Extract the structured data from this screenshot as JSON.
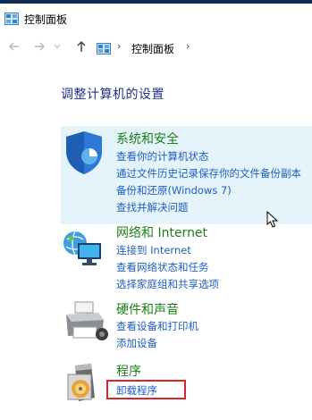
{
  "window": {
    "title": "控制面板"
  },
  "nav": {
    "breadcrumb": "控制面板"
  },
  "page": {
    "title": "调整计算机的设置"
  },
  "categories": [
    {
      "title": "系统和安全",
      "links": [
        "查看你的计算机状态",
        "通过文件历史记录保存你的文件备份副本",
        "备份和还原(Windows 7)",
        "查找并解决问题"
      ]
    },
    {
      "title": "网络和 Internet",
      "links": [
        "连接到 Internet",
        "查看网络状态和任务",
        "选择家庭组和共享选项"
      ]
    },
    {
      "title": "硬件和声音",
      "links": [
        "查看设备和打印机",
        "添加设备"
      ]
    },
    {
      "title": "程序",
      "links": [
        "卸载程序"
      ]
    }
  ],
  "colors": {
    "category_title": "#1a7f19",
    "link": "#1f5fbf",
    "page_title": "#1e3287",
    "hover_bg": "#e5f3fb",
    "highlight_border": "#d9262a"
  }
}
